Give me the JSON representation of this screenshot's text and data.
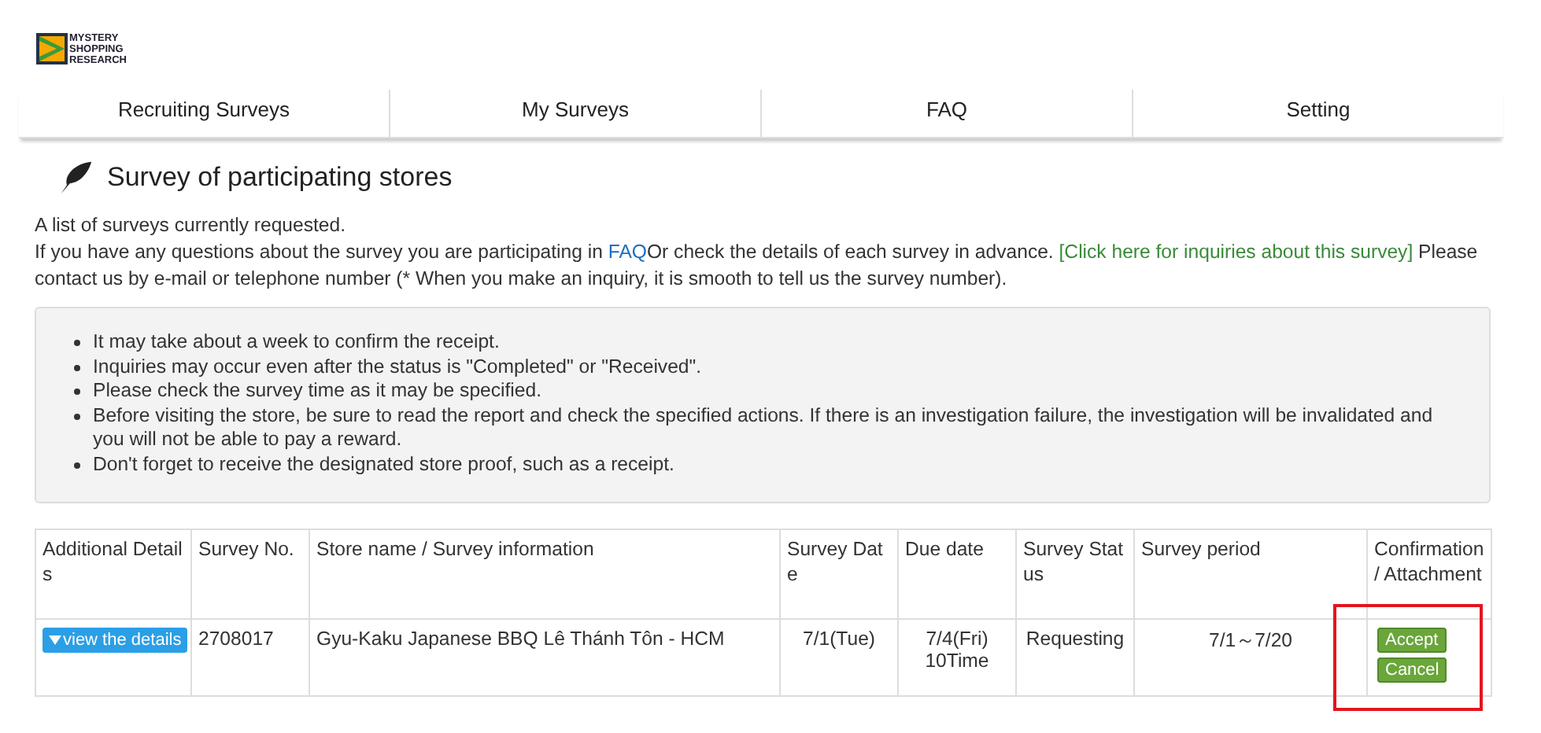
{
  "logo": {
    "lines": [
      "MYSTERY",
      "SHOPPING",
      "RESEARCH"
    ]
  },
  "tabs": [
    {
      "label": "Recruiting Surveys",
      "selected": false
    },
    {
      "label": "My Surveys",
      "selected": false
    },
    {
      "label": "FAQ",
      "selected": false
    },
    {
      "label": "Setting",
      "selected": false
    }
  ],
  "title": "Survey of participating stores",
  "intro": {
    "line1": "A list of surveys currently requested.",
    "before": "If you have any questions about the survey you are participating in ",
    "faq_link": "FAQ",
    "middle": "Or check the details of each survey in advance. ",
    "inquiry_link": "[Click here for inquiries about this survey]",
    "after": " Please contact us by e-mail or telephone number (* When you make an inquiry, it is smooth to tell us the survey number)."
  },
  "notes": [
    "It may take about a week to confirm the receipt.",
    "Inquiries may occur even after the status is \"Completed\" or \"Received\".",
    "Please check the survey time as it may be specified.",
    "Before visiting the store, be sure to read the report and check the specified actions. If there is an investigation failure, the investigation will be invalidated and you will not be able to pay a reward.",
    "Don't forget to receive the designated store proof, such as a receipt."
  ],
  "table": {
    "columns": [
      "Additional Details",
      "Survey No.",
      "Store name / Survey information",
      "Survey Date",
      "Due date",
      "Survey Status",
      "Survey period",
      "Confirmation / Attachment"
    ],
    "rows": [
      {
        "details_button": "view the details",
        "survey_no": "2708017",
        "store": "Gyu-Kaku Japanese BBQ Lê Thánh Tôn - HCM",
        "survey_date": "7/1(Tue)",
        "due_date": [
          "7/4(Fri)",
          "10Time"
        ],
        "status": "Requesting",
        "period": "7/1～7/20",
        "accept": "Accept",
        "cancel": "Cancel",
        "highlighted": true
      }
    ]
  }
}
